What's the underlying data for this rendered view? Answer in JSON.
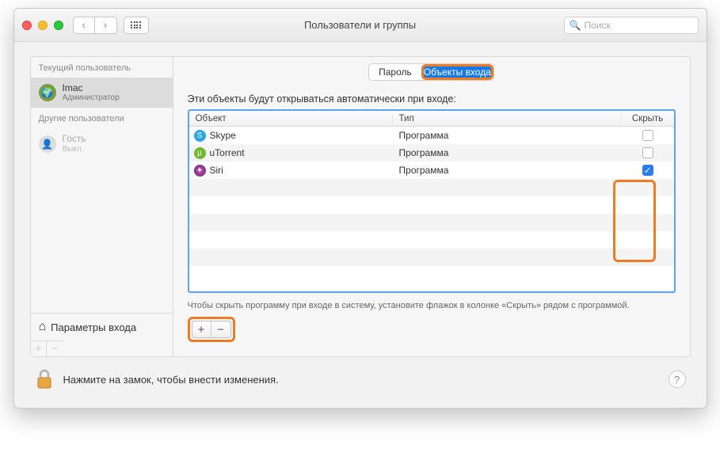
{
  "titlebar": {
    "title": "Пользователи и группы",
    "search_placeholder": "Поиск"
  },
  "sidebar": {
    "current_label": "Текущий пользователь",
    "other_label": "Другие пользователи",
    "current_user": {
      "name": "Imac",
      "role": "Администратор"
    },
    "guest": {
      "name": "Гость",
      "status": "Выкл."
    },
    "login_params": "Параметры входа"
  },
  "tabs": {
    "password": "Пароль",
    "login_items": "Объекты входа"
  },
  "main": {
    "heading": "Эти объекты будут открываться автоматически при входе:",
    "columns": {
      "object": "Объект",
      "type": "Тип",
      "hide": "Скрыть"
    },
    "items": [
      {
        "name": "Skype",
        "type": "Программа",
        "hidden": false,
        "icon": "skype"
      },
      {
        "name": "uTorrent",
        "type": "Программа",
        "hidden": false,
        "icon": "utorrent"
      },
      {
        "name": "Siri",
        "type": "Программа",
        "hidden": true,
        "icon": "siri"
      }
    ],
    "hint": "Чтобы скрыть программу при входе в систему, установите флажок в колонке «Скрыть» рядом с программой."
  },
  "footer": {
    "lock_text": "Нажмите на замок, чтобы внести изменения."
  },
  "glyphs": {
    "search": "🔍",
    "back": "‹",
    "fwd": "›",
    "home": "⌂",
    "plus": "+",
    "minus": "−",
    "check": "✓",
    "help": "?"
  }
}
